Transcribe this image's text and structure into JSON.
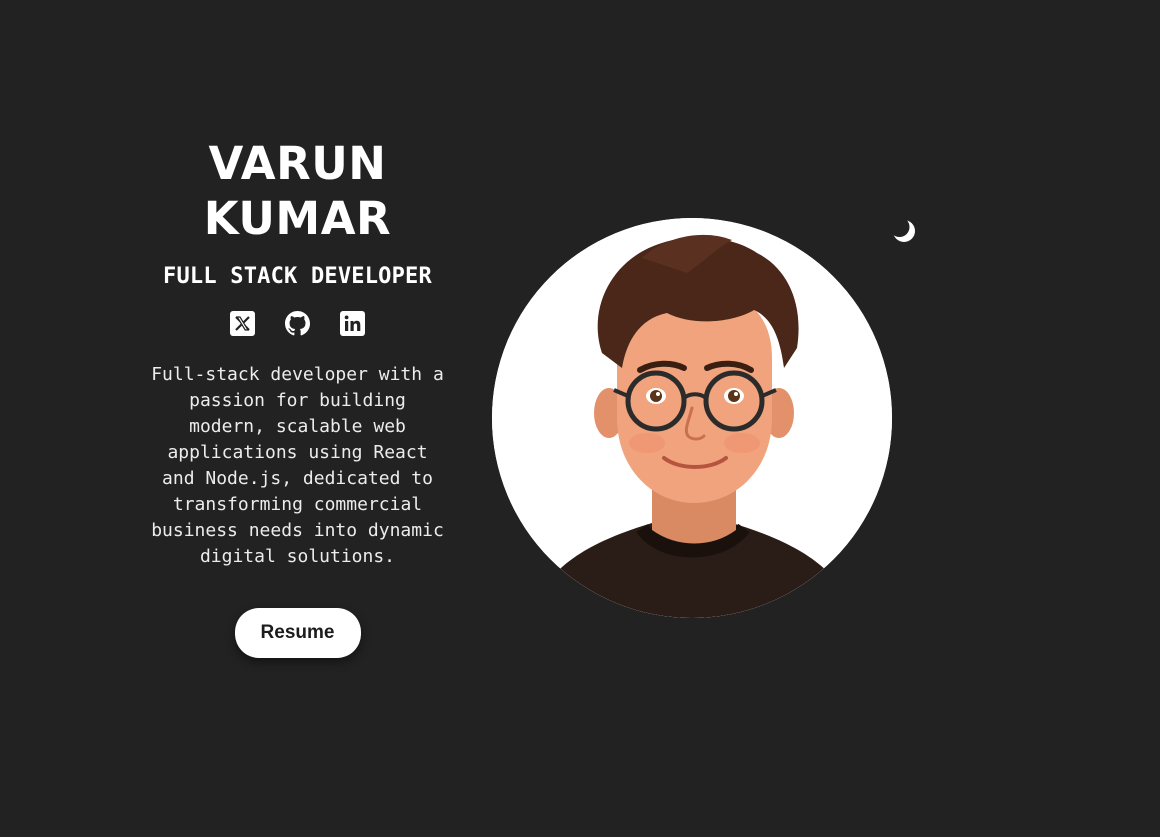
{
  "hero": {
    "name_line1": "VARUN",
    "name_line2": "KUMAR",
    "role": "FULL STACK DEVELOPER",
    "bio": "Full-stack developer with a passion for building modern, scalable web applications using React and Node.js, dedicated to transforming commercial business needs into dynamic digital solutions.",
    "resume_label": "Resume"
  },
  "socials": [
    {
      "icon": "x-twitter-icon"
    },
    {
      "icon": "github-icon"
    },
    {
      "icon": "linkedin-icon"
    }
  ],
  "theme_toggle": {
    "icon": "moon-icon"
  },
  "colors": {
    "background": "#222222",
    "text": "#ffffff",
    "button_bg": "#ffffff",
    "button_text": "#1c1c1c"
  }
}
